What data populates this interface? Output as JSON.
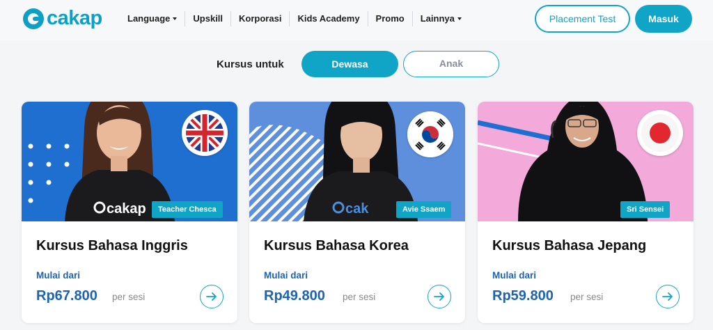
{
  "header": {
    "logo_text": "cakap",
    "nav": [
      {
        "label": "Language",
        "dropdown": true
      },
      {
        "label": "Upskill",
        "dropdown": false
      },
      {
        "label": "Korporasi",
        "dropdown": false
      },
      {
        "label": "Kids Academy",
        "dropdown": false
      },
      {
        "label": "Promo",
        "dropdown": false
      },
      {
        "label": "Lainnya",
        "dropdown": true
      }
    ],
    "placement_test": "Placement Test",
    "masuk": "Masuk"
  },
  "filter": {
    "label": "Kursus untuk",
    "options": [
      "Dewasa",
      "Anak"
    ],
    "selected": "Dewasa"
  },
  "colors": {
    "accent": "#10a4c7",
    "price_blue": "#1e63b0",
    "card1_bg": "#1f6fd1",
    "card2_bg": "#5d8fdc",
    "card3_bg": "#f3a9d9"
  },
  "cards": [
    {
      "title": "Kursus Bahasa Inggris",
      "teacher": "Teacher Chesca",
      "from_label": "Mulai dari",
      "price": "Rp67.800",
      "per": "per sesi",
      "flag": "uk-flag-icon"
    },
    {
      "title": "Kursus Bahasa Korea",
      "teacher": "Avie Ssaem",
      "from_label": "Mulai dari",
      "price": "Rp49.800",
      "per": "per sesi",
      "flag": "korea-flag-icon"
    },
    {
      "title": "Kursus Bahasa Jepang",
      "teacher": "Sri Sensei",
      "from_label": "Mulai dari",
      "price": "Rp59.800",
      "per": "per sesi",
      "flag": "japan-flag-icon"
    }
  ]
}
